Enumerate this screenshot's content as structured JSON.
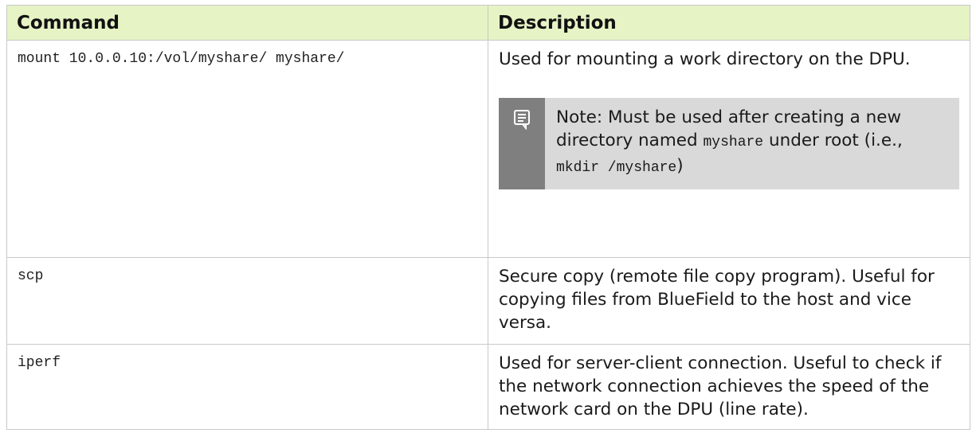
{
  "table": {
    "headers": {
      "command": "Command",
      "description": "Description"
    },
    "rows": [
      {
        "command": "mount 10.0.0.10:/vol/myshare/ myshare/",
        "description": "Used for mounting a work directory on the DPU.",
        "note": {
          "icon": "note-icon",
          "part1": "Note: Must be used after creating a new directory named ",
          "code1": "myshare",
          "part2": " under root (i.e., ",
          "code2": "mkdir /myshare",
          "part3": ")"
        }
      },
      {
        "command": "scp",
        "description": "Secure copy (remote file copy program). Useful for copying files from BlueField to the host and vice versa."
      },
      {
        "command": "iperf",
        "description": "Used for server-client connection. Useful to check if the network connection achieves the speed of the network card on the DPU (line rate)."
      }
    ]
  }
}
